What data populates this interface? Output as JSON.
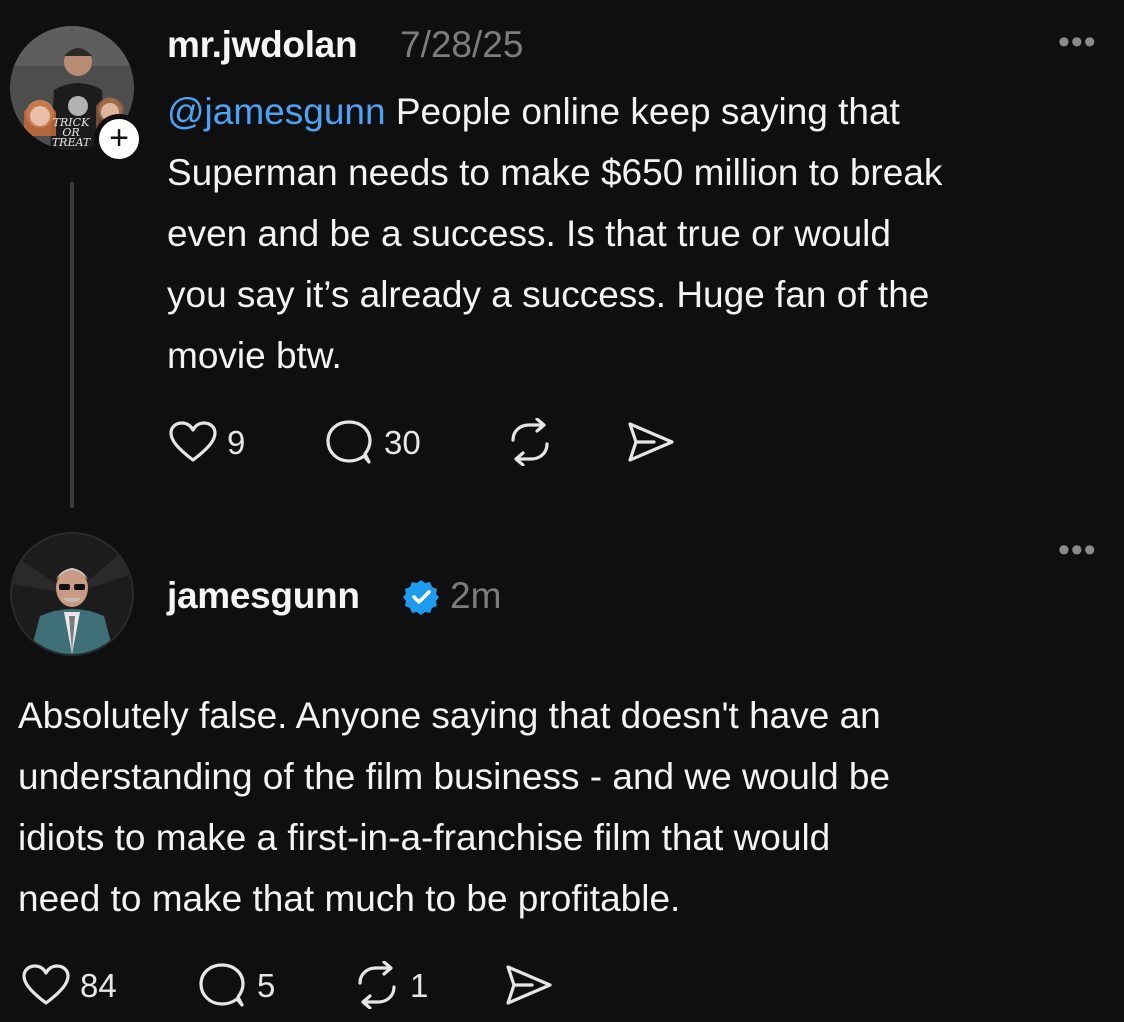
{
  "post": {
    "username": "mr.jwdolan",
    "timestamp": "7/28/25",
    "mention": "@jamesgunn",
    "text_lines": [
      " People online keep saying that",
      "Superman needs to make $650 million to break",
      "even and be a success. Is that true or would",
      "you say it’s already a success. Huge fan of the",
      "movie btw."
    ],
    "more_label": "•••",
    "follow_label": "+",
    "likes": "9",
    "replies": "30",
    "avatar_shirt_text": "TRICK OR TREAT"
  },
  "reply": {
    "username": "jamesgunn",
    "timestamp": "2m",
    "verified_icon": "verified-badge-icon",
    "more_label": "•••",
    "text_lines": [
      "Absolutely false. Anyone saying that doesn't have an",
      "understanding of the film business - and we would be",
      "idiots to make a first-in-a-franchise film that would",
      "need to make that much to be profitable."
    ],
    "likes": "84",
    "replies": "5",
    "reposts": "1"
  },
  "colors": {
    "background": "#0f0f0f",
    "mention": "#4aa3f5",
    "verified": "#1d9bf0",
    "muted": "#7d7d7d"
  }
}
